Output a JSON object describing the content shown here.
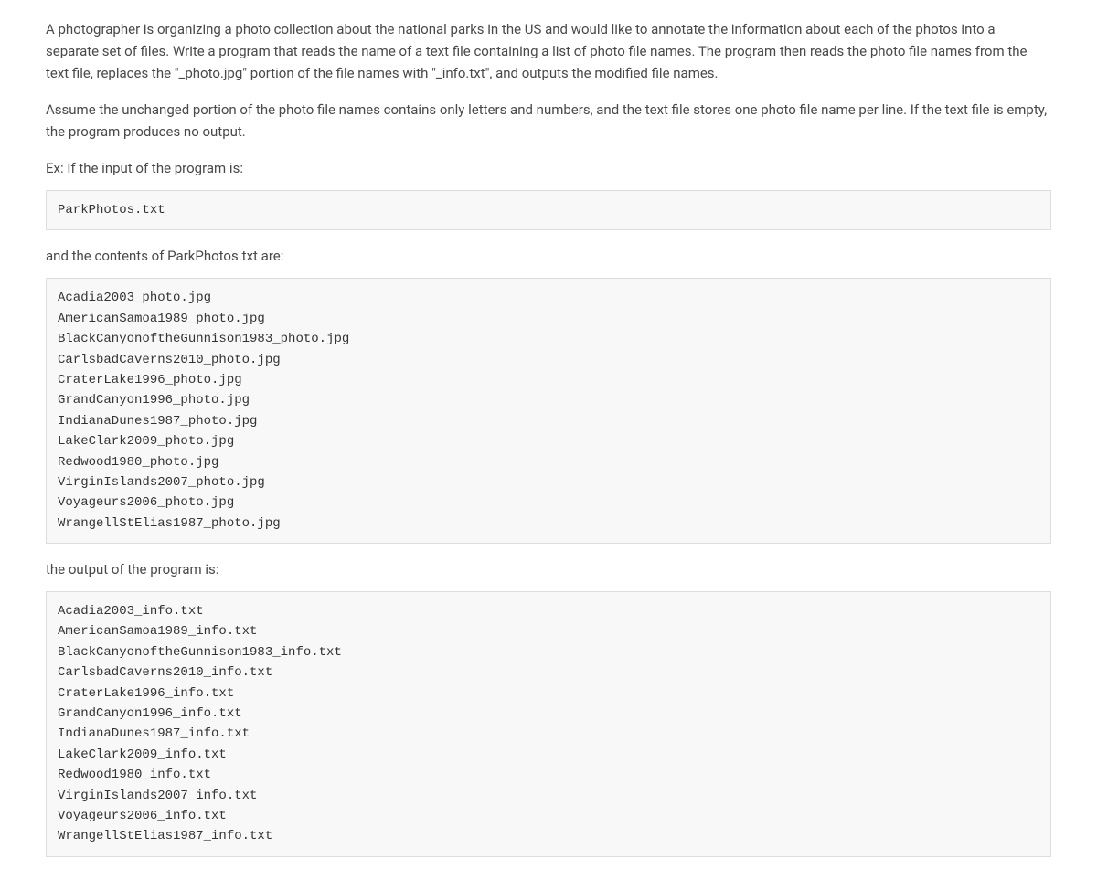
{
  "paragraphs": {
    "intro": "A photographer is organizing a photo collection about the national parks in the US and would like to annotate the information about each of the photos into a separate set of files. Write a program that reads the name of a text file containing a list of photo file names. The program then reads the photo file names from the text file, replaces the \"_photo.jpg\" portion of the file names with \"_info.txt\", and outputs the modified file names.",
    "assumption": "Assume the unchanged portion of the photo file names contains only letters and numbers, and the text file stores one photo file name per line. If the text file is empty, the program produces no output.",
    "example_label": "Ex: If the input of the program is:"
  },
  "code_blocks": {
    "input_filename": "ParkPhotos.txt",
    "contents_label": "and the contents of ParkPhotos.txt are:",
    "file_contents": "Acadia2003_photo.jpg\nAmericanSamoa1989_photo.jpg\nBlackCanyonoftheGunnison1983_photo.jpg\nCarlsbadCaverns2010_photo.jpg\nCraterLake1996_photo.jpg\nGrandCanyon1996_photo.jpg\nIndianaDunes1987_photo.jpg\nLakeClark2009_photo.jpg\nRedwood1980_photo.jpg\nVirginIslands2007_photo.jpg\nVoyageurs2006_photo.jpg\nWrangellStElias1987_photo.jpg",
    "output_label": "the output of the program is:",
    "output_contents": "Acadia2003_info.txt\nAmericanSamoa1989_info.txt\nBlackCanyonoftheGunnison1983_info.txt\nCarlsbadCaverns2010_info.txt\nCraterLake1996_info.txt\nGrandCanyon1996_info.txt\nIndianaDunes1987_info.txt\nLakeClark2009_info.txt\nRedwood1980_info.txt\nVirginIslands2007_info.txt\nVoyageurs2006_info.txt\nWrangellStElias1987_info.txt"
  }
}
